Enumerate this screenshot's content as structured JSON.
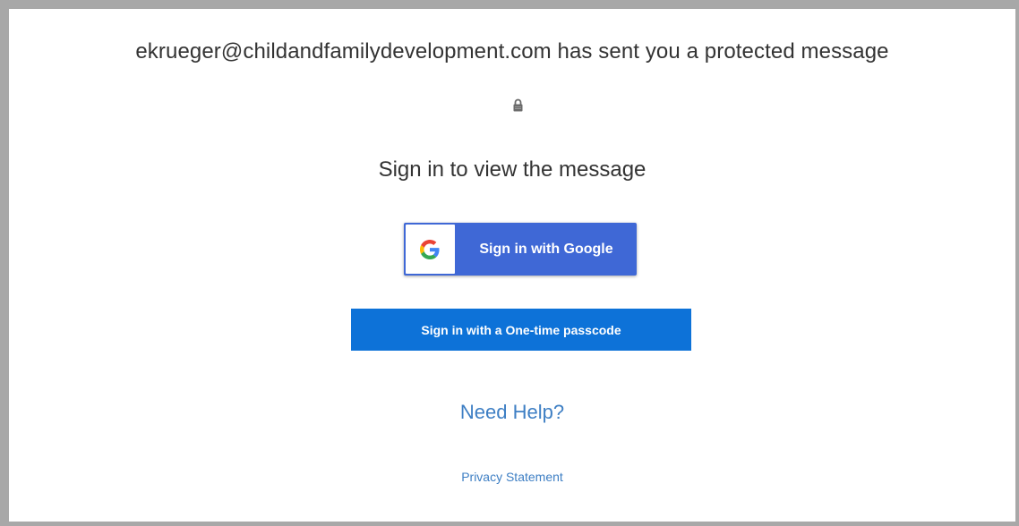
{
  "header": {
    "message": "ekrueger@childandfamilydevelopment.com has sent you a protected message",
    "icon": "lock-icon"
  },
  "main": {
    "subtitle": "Sign in to view the message",
    "google_button": {
      "label": "Sign in with Google",
      "icon": "google-g-icon",
      "color": "#3f68d6"
    },
    "otp_button": {
      "label": "Sign in with a One-time passcode",
      "color": "#0d72d8"
    },
    "help_link": "Need Help?",
    "privacy_link": "Privacy Statement"
  }
}
